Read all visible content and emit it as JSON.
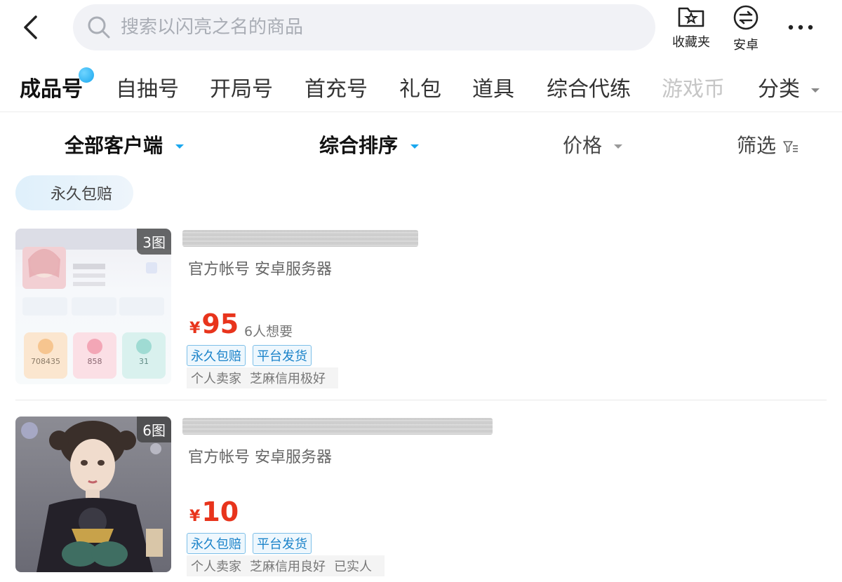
{
  "search": {
    "placeholder": "搜索以闪亮之名的商品"
  },
  "actions": {
    "favorites": "收藏夹",
    "android": "安卓"
  },
  "category_tabs": [
    "成品号",
    "自抽号",
    "开局号",
    "首充号",
    "礼包",
    "道具",
    "综合代练",
    "游戏币",
    "分类"
  ],
  "filters": {
    "client": "全部客户端",
    "sort": "综合排序",
    "price": "价格",
    "filter": "筛选"
  },
  "chip": "永久包赔",
  "listings": [
    {
      "image_count": "3图",
      "meta": "官方帐号 安卓服务器",
      "currency": "¥",
      "price": "95",
      "wanters": "6人想要",
      "tags": [
        "永久包赔",
        "平台发货"
      ],
      "seller_tags": [
        "个人卖家",
        "芝麻信用极好"
      ],
      "thumb_stats": [
        "708435",
        "858",
        "31"
      ]
    },
    {
      "image_count": "6图",
      "meta": "官方帐号 安卓服务器",
      "currency": "¥",
      "price": "10",
      "wanters": "",
      "tags": [
        "永久包赔",
        "平台发货"
      ],
      "seller_tags": [
        "个人卖家",
        "芝麻信用良好",
        "已实人"
      ]
    }
  ],
  "colors": {
    "accent": "#1aa7ee",
    "price": "#e8341c",
    "tag_blue": "#1b83c9"
  }
}
